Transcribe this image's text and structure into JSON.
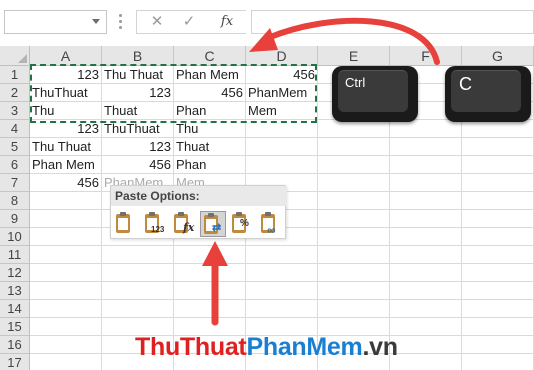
{
  "formula_bar": {
    "name_box_value": "",
    "cancel_glyph": "✕",
    "enter_glyph": "✓",
    "fx_label": "fx",
    "formula_value": ""
  },
  "columns": [
    "A",
    "B",
    "C",
    "D",
    "E",
    "F",
    "G"
  ],
  "rows": [
    "1",
    "2",
    "3",
    "4",
    "5",
    "6",
    "7",
    "8",
    "9",
    "10",
    "11",
    "12",
    "13",
    "14",
    "15",
    "16",
    "17"
  ],
  "cells": {
    "A1": "123",
    "B1": "Thu Thuat",
    "C1": "Phan Mem",
    "D1": "456",
    "A2": "ThuThuat",
    "B2": "123",
    "C2": "456",
    "D2": "PhanMem",
    "A3": "Thu",
    "B3": "Thuat",
    "C3": "Phan",
    "D3": "Mem",
    "A4": "123",
    "B4": "ThuThuat",
    "C4": "Thu",
    "A5": "Thu Thuat",
    "B5": "123",
    "C5": "Thuat",
    "A6": "Phan Mem",
    "B6": "456",
    "C6": "Phan",
    "A7": "456",
    "B7": "PhanMem",
    "C7": "Mem"
  },
  "paste_options": {
    "title": "Paste Options:",
    "icons": [
      {
        "name": "paste-icon",
        "badge": ""
      },
      {
        "name": "paste-values-icon",
        "badge": "123"
      },
      {
        "name": "paste-formulas-icon",
        "badge": "fx"
      },
      {
        "name": "paste-transpose-icon",
        "badge": "",
        "selected": true
      },
      {
        "name": "paste-formatting-icon",
        "badge": "%"
      },
      {
        "name": "paste-link-icon",
        "badge": ""
      }
    ]
  },
  "keys": {
    "ctrl": "Ctrl",
    "c": "C"
  },
  "watermark": {
    "part1": "ThuThuat",
    "part2": "PhanMem",
    "part3": ".vn"
  },
  "colors": {
    "accent_green": "#217346",
    "arrow_red": "#e8413b",
    "watermark_red": "#e02020",
    "watermark_blue": "#1a7fd1"
  }
}
